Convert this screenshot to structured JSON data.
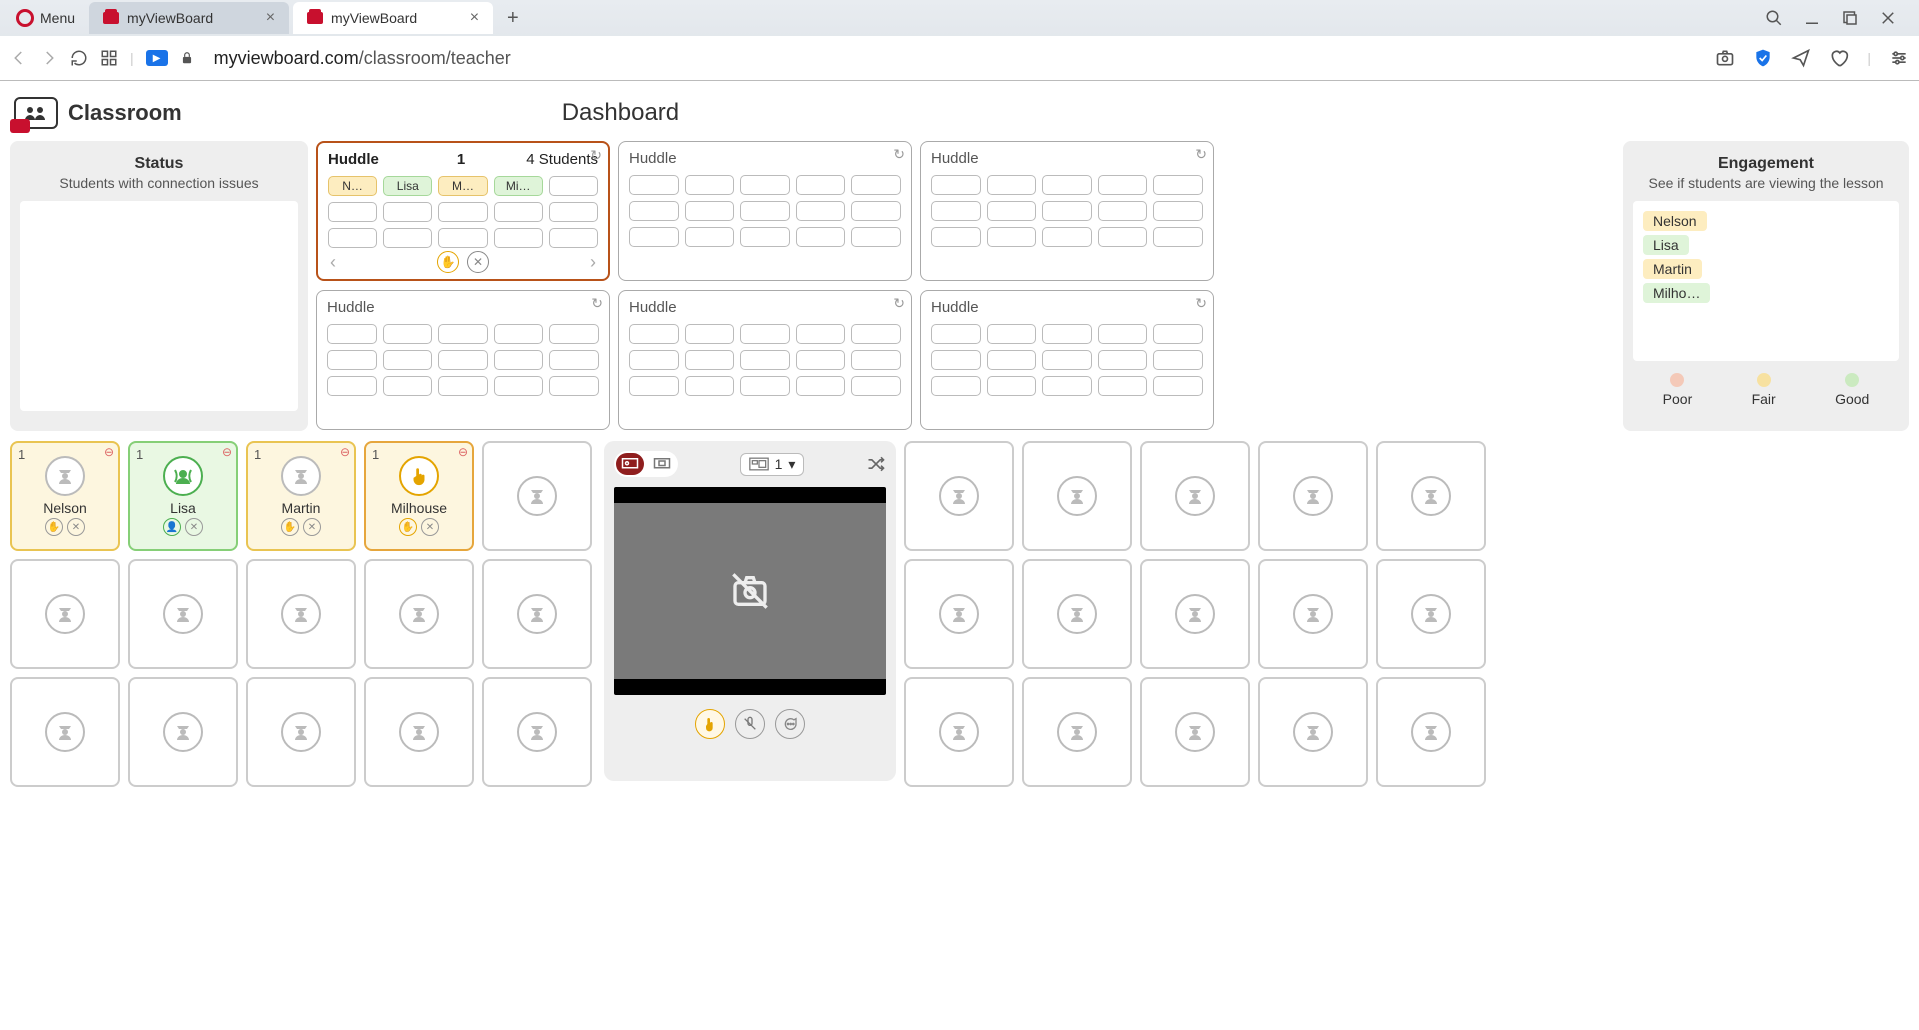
{
  "browser": {
    "menu_label": "Menu",
    "tabs": [
      {
        "title": "myViewBoard",
        "active": false
      },
      {
        "title": "myViewBoard",
        "active": true
      }
    ],
    "url_host": "myviewboard.com",
    "url_path": "/classroom/teacher"
  },
  "app": {
    "logo_title": "Classroom",
    "page_title": "Dashboard"
  },
  "status_panel": {
    "title": "Status",
    "subtitle": "Students with connection issues"
  },
  "huddles": [
    {
      "label": "Huddle",
      "number": "1",
      "count": "4 Students",
      "students": [
        "N…",
        "Lisa",
        "M…",
        "Mi…"
      ],
      "active": true
    },
    {
      "label": "Huddle",
      "number": "",
      "count": "",
      "students": [],
      "active": false
    },
    {
      "label": "Huddle",
      "number": "",
      "count": "",
      "students": [],
      "active": false
    },
    {
      "label": "Huddle",
      "number": "",
      "count": "",
      "students": [],
      "active": false
    },
    {
      "label": "Huddle",
      "number": "",
      "count": "",
      "students": [],
      "active": false
    },
    {
      "label": "Huddle",
      "number": "",
      "count": "",
      "students": [],
      "active": false
    }
  ],
  "huddle_colors": [
    "yellow",
    "green",
    "yellow",
    "green"
  ],
  "engagement_panel": {
    "title": "Engagement",
    "subtitle": "See if students are viewing the lesson",
    "students": [
      {
        "name": "Nelson",
        "level": "yellow"
      },
      {
        "name": "Lisa",
        "level": "green"
      },
      {
        "name": "Martin",
        "level": "yellow"
      },
      {
        "name": "Milho…",
        "level": "green"
      }
    ],
    "legend": {
      "poor": "Poor",
      "fair": "Fair",
      "good": "Good"
    }
  },
  "students": [
    {
      "name": "Nelson",
      "num": "1",
      "style": "yellow",
      "avatar": "default"
    },
    {
      "name": "Lisa",
      "num": "1",
      "style": "green",
      "avatar": "broadcast"
    },
    {
      "name": "Martin",
      "num": "1",
      "style": "yellow",
      "avatar": "default"
    },
    {
      "name": "Milhouse",
      "num": "1",
      "style": "orange",
      "avatar": "hand"
    }
  ],
  "preview": {
    "layout_value": "1"
  }
}
